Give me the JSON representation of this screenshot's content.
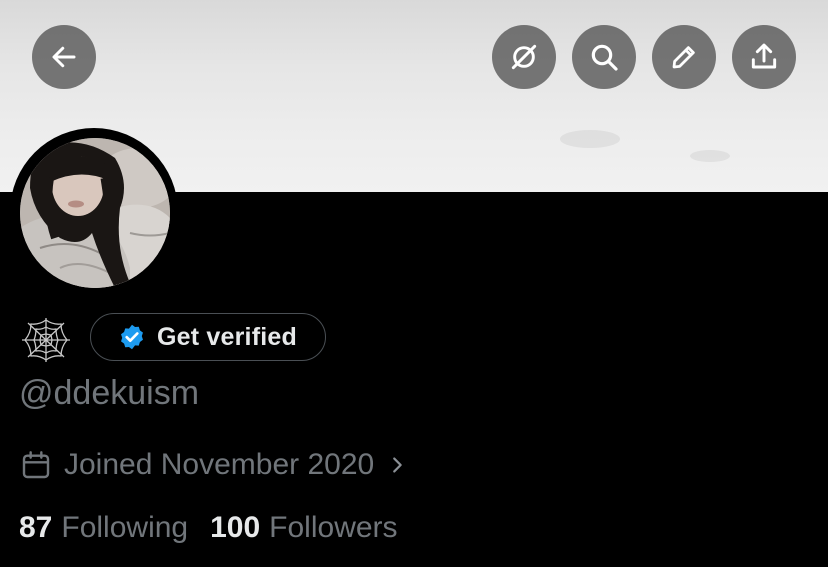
{
  "header": {
    "buttons": [
      "back",
      "hide-translation",
      "search",
      "edit",
      "share"
    ]
  },
  "profile": {
    "verify_label": "Get verified",
    "handle": "@ddekuism",
    "joined": "Joined November 2020",
    "following_count": "87",
    "following_label": "Following",
    "followers_count": "100",
    "followers_label": "Followers"
  },
  "icons": {
    "back": "arrow-left-icon",
    "hide": "circle-slash-icon",
    "search": "search-icon",
    "edit": "pencil-icon",
    "share": "share-upload-icon",
    "emoji": "spider-web-icon",
    "badge": "verified-badge-icon",
    "calendar": "calendar-icon",
    "chevron": "chevron-right-icon"
  },
  "colors": {
    "background": "#000000",
    "primary_text": "#e7e9ea",
    "secondary_text": "#71767b",
    "verified_blue": "#1d9bf0",
    "pill_border": "#4a4f54",
    "nav_button": "#5a5a5a"
  }
}
